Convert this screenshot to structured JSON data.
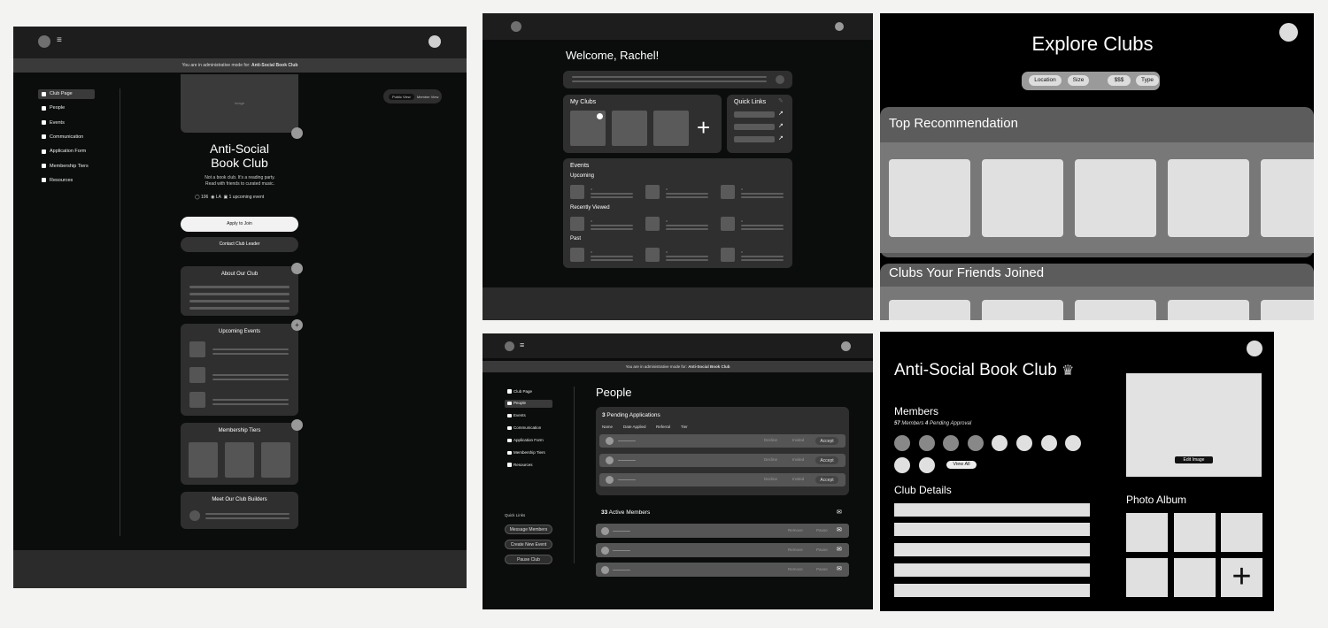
{
  "p1": {
    "admin_prefix": "You are in administrative mode for: ",
    "admin_club": "Anti-Social Book Club",
    "sidebar": [
      "Club Page",
      "People",
      "Events",
      "Communication",
      "Application Form",
      "Membership Tiers",
      "Resources"
    ],
    "view_toggle": [
      "Public View",
      "Member View"
    ],
    "banner_label": "Image",
    "title_line1": "Anti-Social",
    "title_line2": "Book Club",
    "tagline1": "Not a book club. It's a reading party.",
    "tagline2": "Read with friends to curated music.",
    "stat_members": "106",
    "stat_location": "LA",
    "stat_events": "1 upcoming event",
    "apply": "Apply to Join",
    "contact": "Contact Club Leader",
    "about": "About Our Club",
    "upcoming": "Upcoming Events",
    "tiers": "Membership Tiers",
    "builders": "Meet Our Club Builders"
  },
  "p2": {
    "welcome": "Welcome, Rachel!",
    "my_clubs": "My Clubs",
    "quick_links": "Quick Links",
    "events": "Events",
    "upcoming": "Upcoming",
    "recent": "Recently Viewed",
    "past": "Past"
  },
  "p3": {
    "title": "Explore Clubs",
    "filters": [
      "Location",
      "Size",
      "$$$",
      "Type"
    ],
    "top": "Top Recommendation",
    "friends": "Clubs Your Friends Joined"
  },
  "p4": {
    "admin_prefix": "You are in administrative mode for: ",
    "admin_club": "Anti-Social Book Club",
    "sidebar": [
      "Club Page",
      "People",
      "Events",
      "Communication",
      "Application Form",
      "Membership Tiers",
      "Resources"
    ],
    "quick_links": "Quick Links",
    "actions": [
      "Message Members",
      "Create New Event",
      "Pause Club"
    ],
    "title": "People",
    "pending_count": "3",
    "pending_label": " Pending Applications",
    "cols": [
      "Name",
      "Date Applied",
      "Referral",
      "Tier"
    ],
    "pending_rows": [
      [
        "Decline",
        "Invited",
        "Accept"
      ],
      [
        "Decline",
        "Invited",
        "Accept"
      ],
      [
        "Decline",
        "Invited",
        "Accept"
      ]
    ],
    "active_count": "33",
    "active_label": " Active Members",
    "active_rows": [
      [
        "Remove",
        "Pause"
      ],
      [
        "Remove",
        "Pause"
      ],
      [
        "Remove",
        "Pause"
      ]
    ]
  },
  "p5": {
    "title": "Anti-Social Book Club",
    "members": "Members",
    "member_count": "57",
    "member_text": " Members ",
    "pending_count": "4",
    "pending_text": " Pending Approval",
    "view_all": "View All",
    "details": "Club Details",
    "edit_image": "Edit Image",
    "album": "Photo Album"
  }
}
